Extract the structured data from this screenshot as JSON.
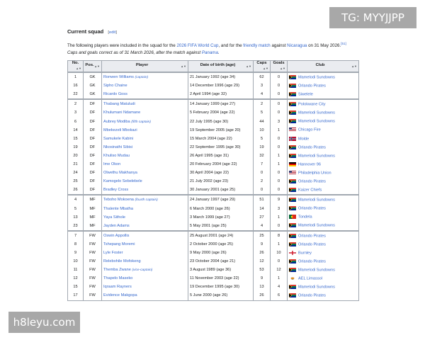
{
  "watermarks": {
    "top": "TG: MYYJJPP",
    "bottom": "h8leyu.com"
  },
  "section": {
    "title": "Current squad",
    "edit_bracket_open": "[",
    "edit_label": "edit",
    "edit_bracket_close": "]",
    "intro_1": "The following players were included in the squad for the ",
    "intro_link_1": "2026 FIFA World Cup",
    "intro_2": ", and for the ",
    "intro_link_2": "friendly match",
    "intro_3": " against ",
    "intro_link_3": "Nicaragua",
    "intro_4": " on 31 May 2026.",
    "intro_ref": "[51]",
    "caps_1": "Caps and goals correct as of 31 March 2026, after the match against ",
    "caps_link": "Panama",
    "caps_2": "."
  },
  "table": {
    "headers": [
      "No.",
      "Pos.",
      "Player",
      "Date of birth (age)",
      "Caps",
      "Goals",
      "Club"
    ],
    "groups": [
      [
        {
          "no": "1",
          "pos": "GK",
          "player": "Ronwen Williams",
          "note": "(captain)",
          "dob": "21 January 1992 (age 34)",
          "caps": "62",
          "goals": "0",
          "club": "Mamelodi Sundowns",
          "flag": "za"
        },
        {
          "no": "16",
          "pos": "GK",
          "player": "Sipho Chaine",
          "note": "",
          "dob": "14 December 1996 (age 29)",
          "caps": "3",
          "goals": "0",
          "club": "Orlando Pirates",
          "flag": "za"
        },
        {
          "no": "22",
          "pos": "GK",
          "player": "Ricardo Goss",
          "note": "",
          "dob": "2 April 1994 (age 32)",
          "caps": "4",
          "goals": "0",
          "club": "Siwelele",
          "flag": "za"
        }
      ],
      [
        {
          "no": "2",
          "pos": "DF",
          "player": "Thabang Matuludi",
          "note": "",
          "dob": "14 January 1999 (age 27)",
          "caps": "2",
          "goals": "0",
          "club": "Polokwane City",
          "flag": "za"
        },
        {
          "no": "3",
          "pos": "DF",
          "player": "Khulumani Ndamane",
          "note": "",
          "dob": "5 February 2004 (age 22)",
          "caps": "5",
          "goals": "0",
          "club": "Mamelodi Sundowns",
          "flag": "za"
        },
        {
          "no": "6",
          "pos": "DF",
          "player": "Aubrey Modiba",
          "note": "(fifth captain)",
          "dob": "22 July 1995 (age 30)",
          "caps": "44",
          "goals": "3",
          "club": "Mamelodi Sundowns",
          "flag": "za"
        },
        {
          "no": "14",
          "pos": "DF",
          "player": "Mbekezeli Mbokazi",
          "note": "",
          "dob": "19 September 2005 (age 20)",
          "caps": "10",
          "goals": "1",
          "club": "Chicago Fire",
          "flag": "us"
        },
        {
          "no": "15",
          "pos": "DF",
          "player": "Samukele Kabini",
          "note": "",
          "dob": "15 March 2004 (age 22)",
          "caps": "5",
          "goals": "0",
          "club": "Molde",
          "flag": "no"
        },
        {
          "no": "19",
          "pos": "DF",
          "player": "Nkosinathi Sibisi",
          "note": "",
          "dob": "22 September 1995 (age 30)",
          "caps": "19",
          "goals": "0",
          "club": "Orlando Pirates",
          "flag": "za"
        },
        {
          "no": "20",
          "pos": "DF",
          "player": "Khuliso Mudau",
          "note": "",
          "dob": "26 April 1995 (age 31)",
          "caps": "32",
          "goals": "1",
          "club": "Mamelodi Sundowns",
          "flag": "za"
        },
        {
          "no": "21",
          "pos": "DF",
          "player": "Ime Okon",
          "note": "",
          "dob": "20 February 2004 (age 22)",
          "caps": "7",
          "goals": "1",
          "club": "Hannover 96",
          "flag": "de"
        },
        {
          "no": "24",
          "pos": "DF",
          "player": "Olwethu Makhanya",
          "note": "",
          "dob": "30 April 2004 (age 22)",
          "caps": "0",
          "goals": "0",
          "club": "Philadelphia Union",
          "flag": "us"
        },
        {
          "no": "25",
          "pos": "DF",
          "player": "Kamogelo Sebelebele",
          "note": "",
          "dob": "21 July 2002 (age 23)",
          "caps": "2",
          "goals": "0",
          "club": "Orlando Pirates",
          "flag": "za"
        },
        {
          "no": "26",
          "pos": "DF",
          "player": "Bradley Cross",
          "note": "",
          "dob": "30 January 2001 (age 25)",
          "caps": "0",
          "goals": "0",
          "club": "Kaizer Chiefs",
          "flag": "za"
        }
      ],
      [
        {
          "no": "4",
          "pos": "MF",
          "player": "Teboho Mokoena",
          "note": "(fourth captain)",
          "dob": "24 January 1997 (age 29)",
          "caps": "51",
          "goals": "9",
          "club": "Mamelodi Sundowns",
          "flag": "za"
        },
        {
          "no": "5",
          "pos": "MF",
          "player": "Thalente Mbatha",
          "note": "",
          "dob": "6 March 2000 (age 26)",
          "caps": "14",
          "goals": "3",
          "club": "Orlando Pirates",
          "flag": "za"
        },
        {
          "no": "13",
          "pos": "MF",
          "player": "Yaya Sithole",
          "note": "",
          "dob": "3 March 1999 (age 27)",
          "caps": "27",
          "goals": "1",
          "club": "Tondela",
          "flag": "pt"
        },
        {
          "no": "23",
          "pos": "MF",
          "player": "Jayden Adams",
          "note": "",
          "dob": "5 May 2001 (age 25)",
          "caps": "4",
          "goals": "0",
          "club": "Mamelodi Sundowns",
          "flag": "za"
        }
      ],
      [
        {
          "no": "7",
          "pos": "FW",
          "player": "Oswin Appollis",
          "note": "",
          "dob": "25 August 2001 (age 24)",
          "caps": "25",
          "goals": "8",
          "club": "Orlando Pirates",
          "flag": "za"
        },
        {
          "no": "8",
          "pos": "FW",
          "player": "Tshepang Moremi",
          "note": "",
          "dob": "2 October 2000 (age 25)",
          "caps": "9",
          "goals": "1",
          "club": "Orlando Pirates",
          "flag": "za"
        },
        {
          "no": "9",
          "pos": "FW",
          "player": "Lyle Foster",
          "note": "",
          "dob": "9 May 2000 (age 26)",
          "caps": "26",
          "goals": "10",
          "club": "Burnley",
          "flag": "en"
        },
        {
          "no": "10",
          "pos": "FW",
          "player": "Relebohile Mofokeng",
          "note": "",
          "dob": "23 October 2004 (age 21)",
          "caps": "12",
          "goals": "0",
          "club": "Orlando Pirates",
          "flag": "za"
        },
        {
          "no": "11",
          "pos": "FW",
          "player": "Themba Zwane",
          "note": "(vice-captain)",
          "dob": "3 August 1989 (age 36)",
          "caps": "53",
          "goals": "12",
          "club": "Mamelodi Sundowns",
          "flag": "za"
        },
        {
          "no": "12",
          "pos": "FW",
          "player": "Thapelo Maseko",
          "note": "",
          "dob": "11 November 2003 (age 22)",
          "caps": "9",
          "goals": "1",
          "club": "AEL Limassol",
          "flag": "cy"
        },
        {
          "no": "15",
          "pos": "FW",
          "player": "Iqraam Rayners",
          "note": "",
          "dob": "19 December 1995 (age 30)",
          "caps": "13",
          "goals": "4",
          "club": "Mamelodi Sundowns",
          "flag": "za"
        },
        {
          "no": "17",
          "pos": "FW",
          "player": "Evidence Makgopa",
          "note": "",
          "dob": "5 June 2000 (age 26)",
          "caps": "26",
          "goals": "6",
          "club": "Orlando Pirates",
          "flag": "za"
        }
      ]
    ]
  },
  "flag_colors": {
    "za": "#007a4d",
    "us": "#b22234",
    "no": "#ba0c2f",
    "de": "#000000",
    "pt": "#046a38",
    "en": "#ffffff",
    "cy": "#ffffff"
  }
}
